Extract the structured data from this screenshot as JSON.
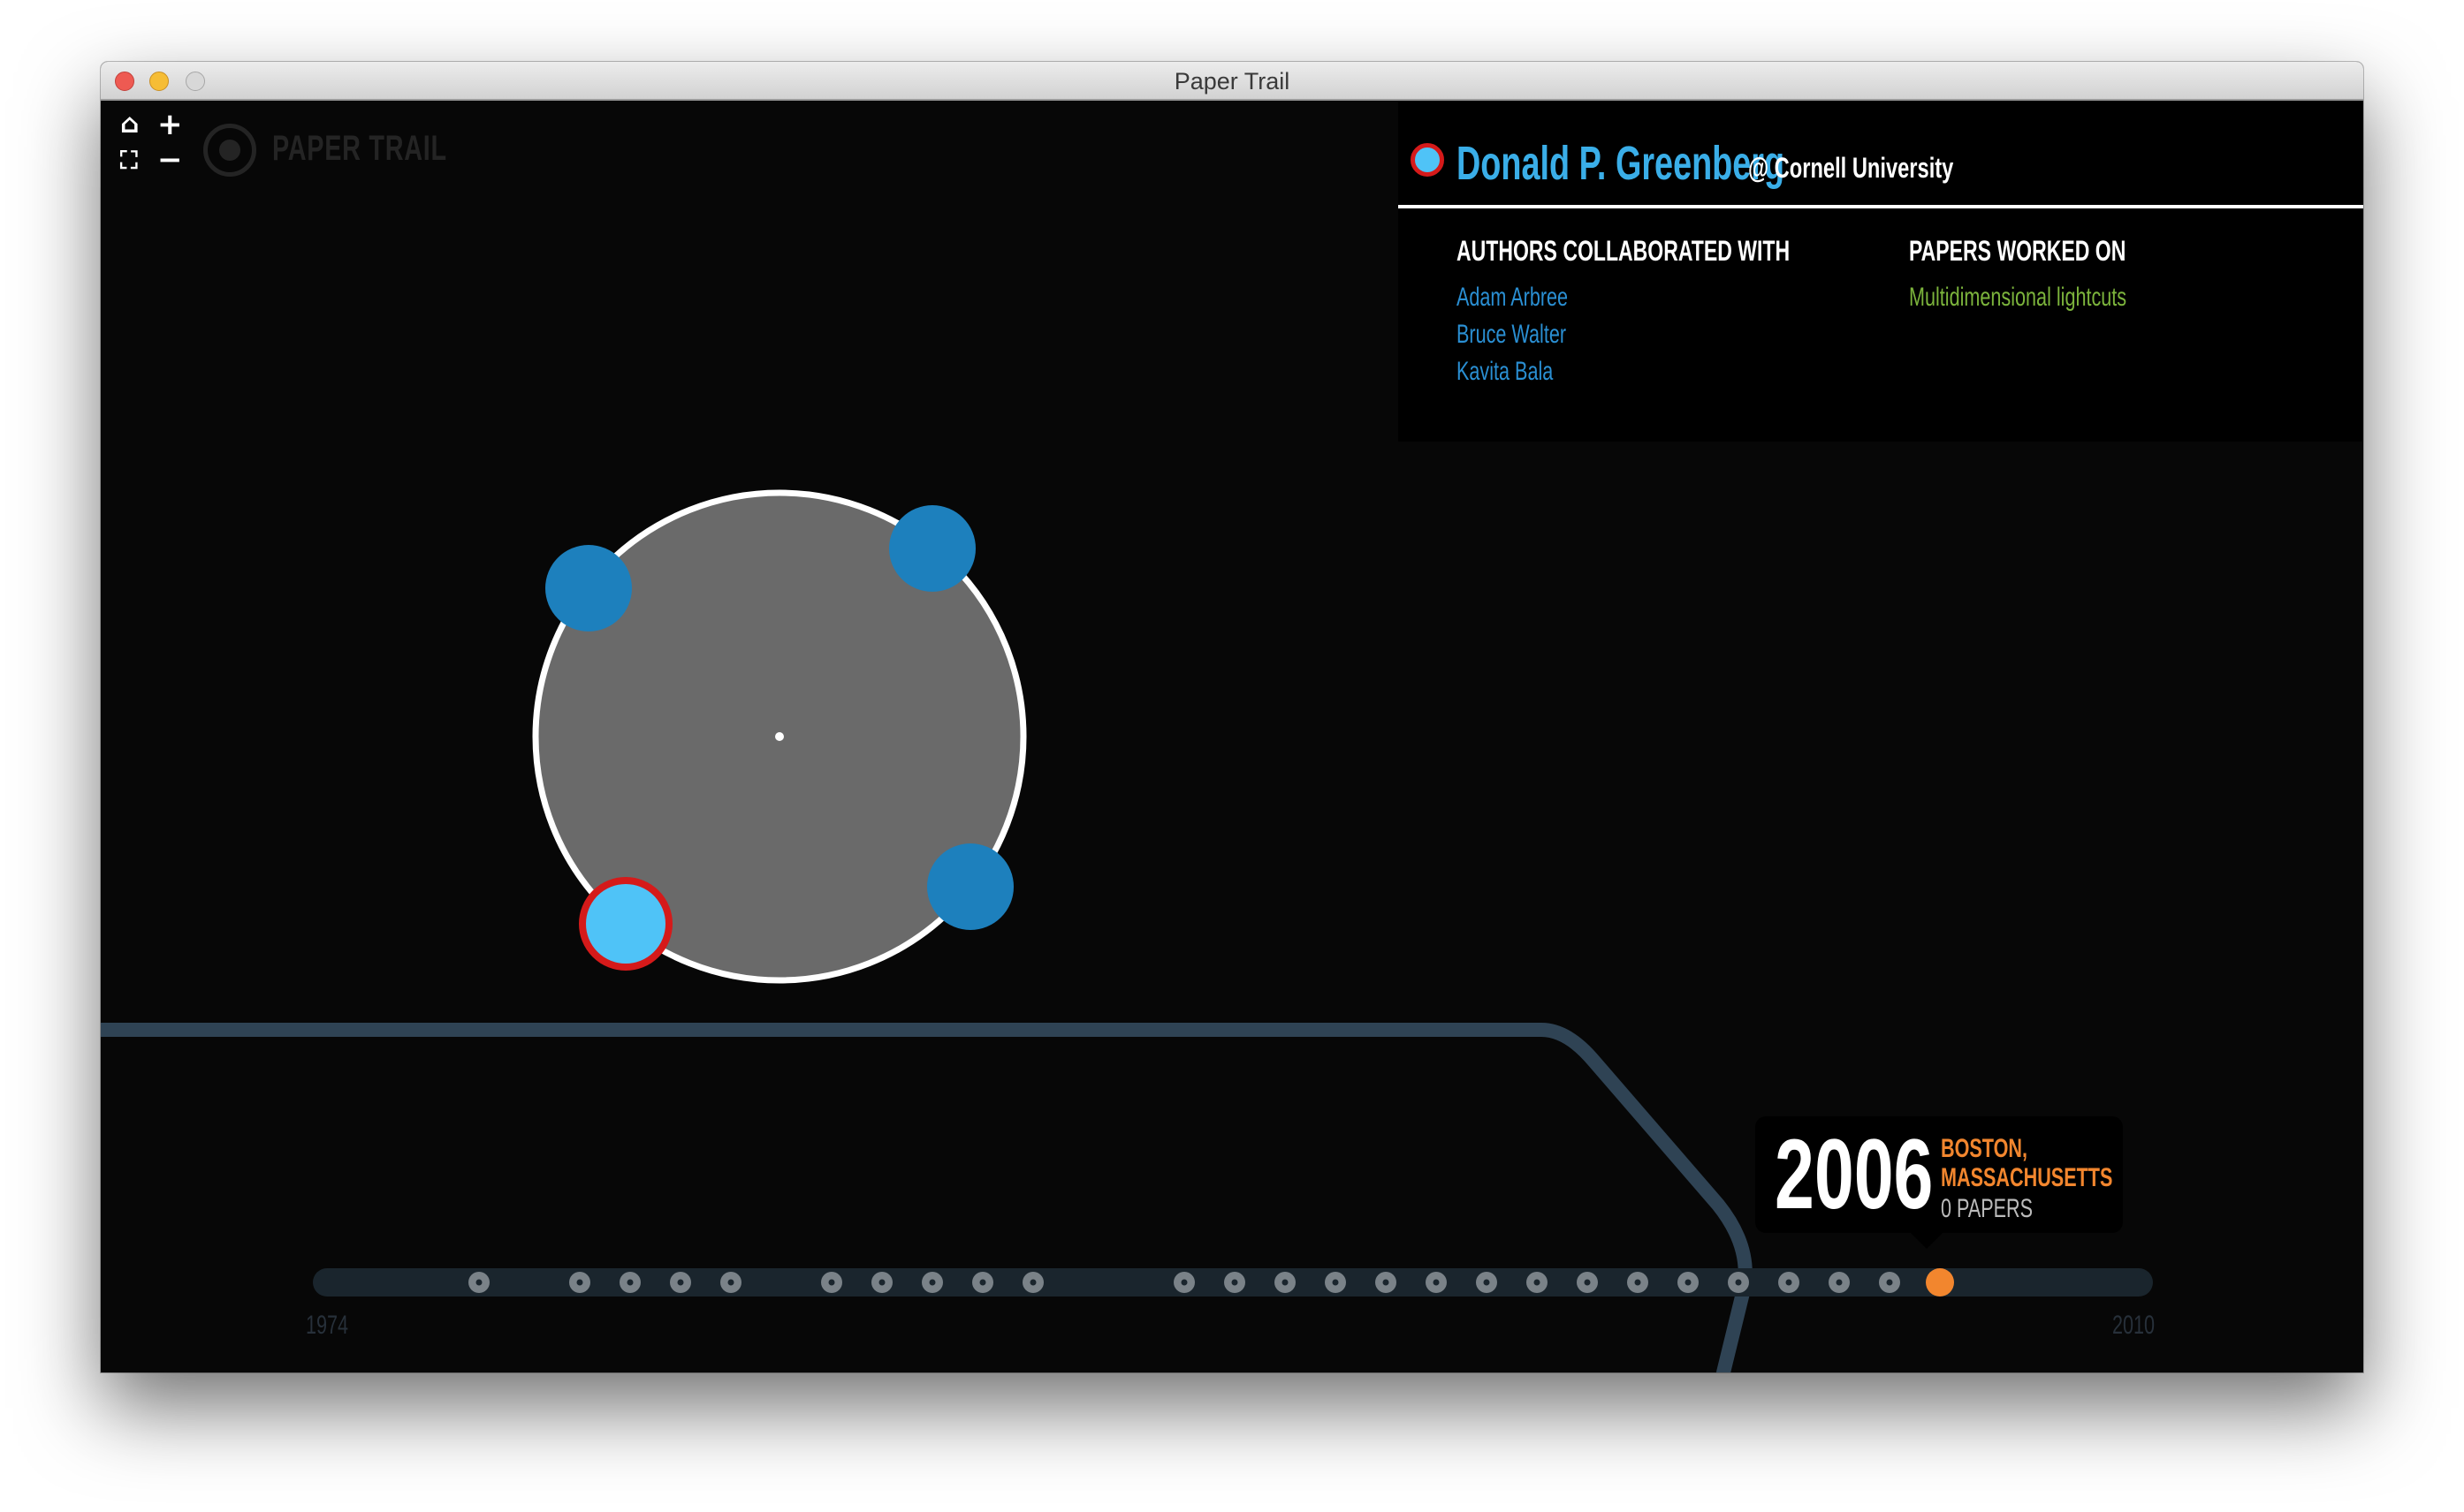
{
  "window": {
    "title": "Paper Trail"
  },
  "toolbar": {
    "home_glyph": "⌂",
    "zoom_in_glyph": "+",
    "fit_glyph": "⛶",
    "zoom_out_glyph": "−"
  },
  "logo": {
    "text": "PAPER TRAIL"
  },
  "profile": {
    "name": "Donald P. Greenberg",
    "affiliation": "@ Cornell University",
    "authors_heading": "AUTHORS COLLABORATED WITH",
    "papers_heading": "PAPERS WORKED ON",
    "authors": [
      "Adam Arbree",
      "Bruce Walter",
      "Kavita Bala"
    ],
    "papers": [
      "Multidimensional lightcuts"
    ]
  },
  "graph": {
    "authors_in_cluster": 4,
    "selected_author_index": 3
  },
  "timeline": {
    "start_label": "1974",
    "end_label": "2010",
    "start_year": 1974,
    "end_year": 2010,
    "marked_years": [
      1977,
      1979,
      1980,
      1981,
      1982,
      1984,
      1985,
      1986,
      1987,
      1988,
      1991,
      1992,
      1993,
      1994,
      1995,
      1996,
      1997,
      1998,
      1999,
      2000,
      2001,
      2002,
      2003,
      2004,
      2005
    ],
    "selected_year": 2006,
    "selected": {
      "year": "2006",
      "city": "BOSTON,",
      "state": "MASSACHUSETTS",
      "papers": "0 PAPERS"
    }
  },
  "colors": {
    "background": "#070707",
    "author_accent": "#3aaee8",
    "author_link": "#2a8fd3",
    "paper_link": "#7cb43c",
    "selected_year": "#f2862e",
    "selected_ring": "#d51a1a"
  }
}
